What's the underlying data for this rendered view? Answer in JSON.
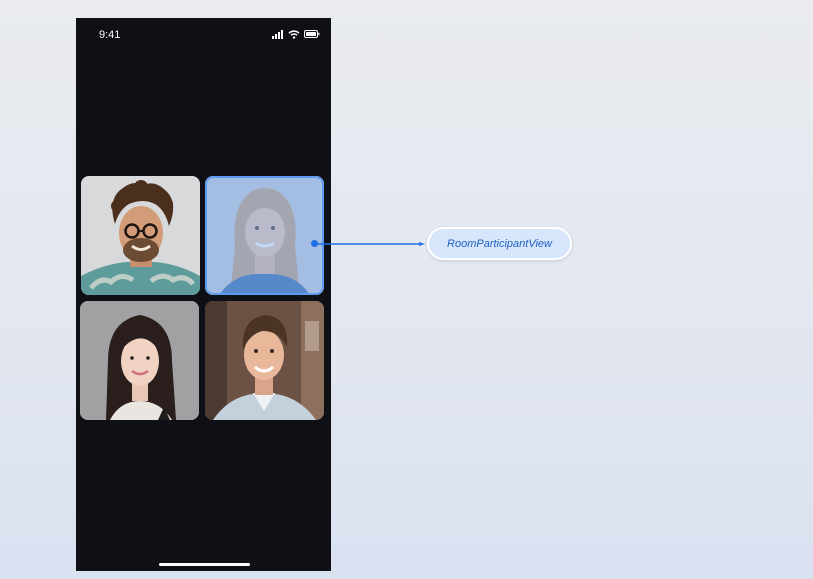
{
  "status_bar": {
    "time": "9:41",
    "icons": [
      "signal-icon",
      "wifi-icon",
      "battery-icon"
    ]
  },
  "participants": [
    {
      "name": "participant-1",
      "icon": "avatar-curly-hair-glasses",
      "highlighted": false
    },
    {
      "name": "participant-2",
      "icon": "avatar-blonde-woman",
      "highlighted": true
    },
    {
      "name": "participant-3",
      "icon": "avatar-dark-hair-woman",
      "highlighted": false
    },
    {
      "name": "participant-4",
      "icon": "avatar-man-blazer",
      "highlighted": false
    }
  ],
  "callout": {
    "label": "RoomParticipantView"
  },
  "colors": {
    "phone_background": "#0f1016",
    "accent": "#1e6fe8",
    "pill_background": "#d7e6fb",
    "pill_text": "#1b5fc4",
    "highlight_border": "#5f9bf1"
  }
}
